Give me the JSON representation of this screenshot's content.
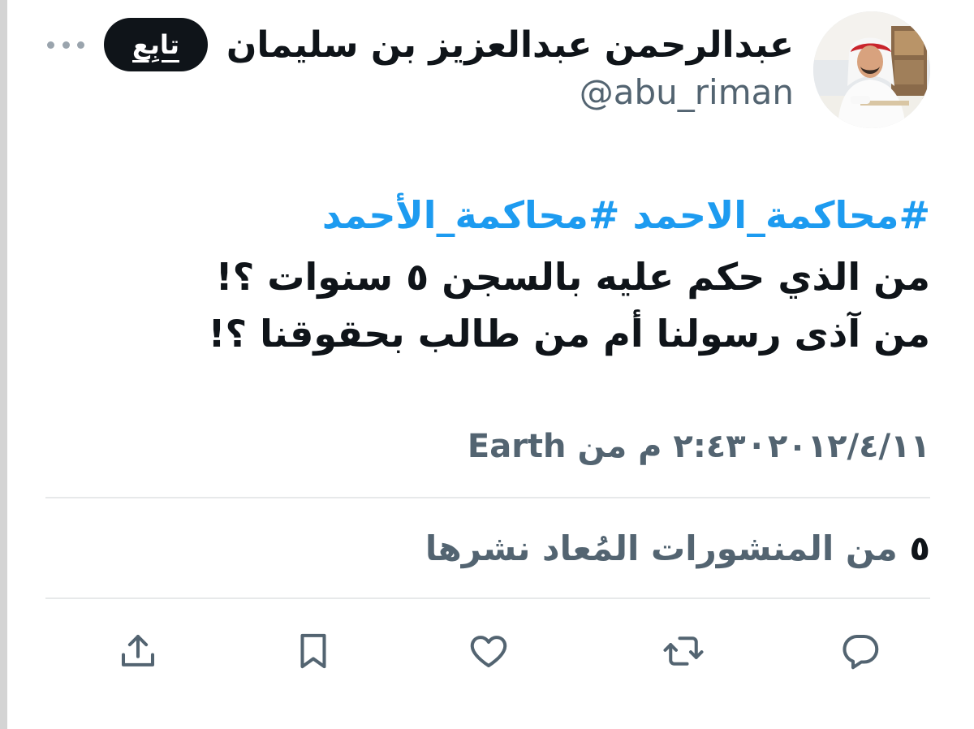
{
  "author": {
    "display_name": "عبدالرحمن عبدالعزيز بن سليمان",
    "handle": "@abu_riman",
    "follow_label": "تابِع"
  },
  "tweet": {
    "hashtags": [
      "#محاكمة_الاحمد",
      "#محاكمة_الأحمد"
    ],
    "lines": [
      "من الذي حكم عليه بالسجن ٥ سنوات ؟!",
      "من آذى رسولنا أم من طالب بحقوقنا ؟!"
    ],
    "date": "٢٠١٢/٤/١١",
    "separator": "·",
    "time": "٢:٤٣ م",
    "from_prefix": "من",
    "source": "Earth"
  },
  "stats": {
    "repost_count": "٥",
    "repost_label": "من المنشورات المُعاد نشرها"
  },
  "icons": {
    "more": "more-horizontal-icon",
    "reply": "reply-bubble-icon",
    "repost": "repost-arrows-icon",
    "like": "heart-icon",
    "bookmark": "bookmark-icon",
    "share": "share-upload-icon"
  },
  "colors": {
    "text": "#0f1419",
    "muted": "#536471",
    "link": "#1d9bf0",
    "follow_bg": "#0f1419",
    "divider": "#e7e9ea"
  }
}
